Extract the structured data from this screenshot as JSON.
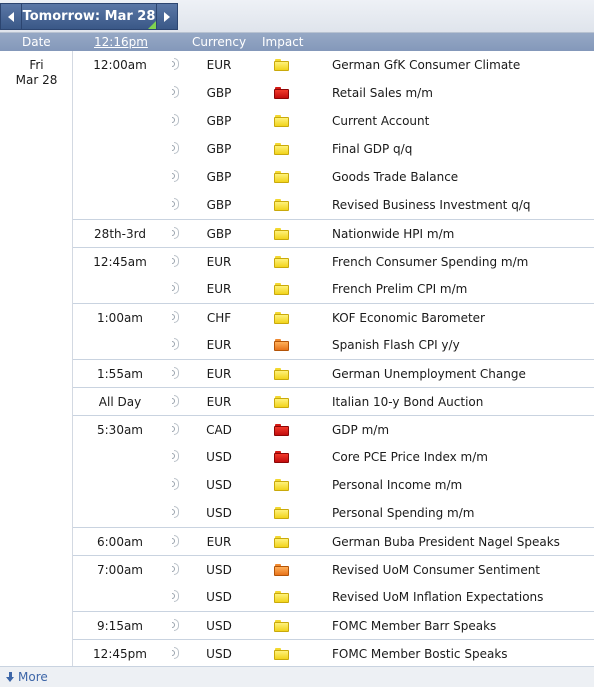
{
  "nav": {
    "label": "Tomorrow: Mar 28"
  },
  "header": {
    "date": "Date",
    "time": "12:16pm",
    "currency": "Currency",
    "impact": "Impact"
  },
  "day": {
    "weekday": "Fri",
    "date": "Mar 28"
  },
  "impact_colors": {
    "yellow": "#f1d31b",
    "red": "#c20d0d",
    "orange": "#e8731a"
  },
  "rows": [
    {
      "time": "12:00am",
      "currency": "EUR",
      "impact": "yellow",
      "event": "German GfK Consumer Climate"
    },
    {
      "time": "",
      "currency": "GBP",
      "impact": "red",
      "event": "Retail Sales m/m"
    },
    {
      "time": "",
      "currency": "GBP",
      "impact": "yellow",
      "event": "Current Account"
    },
    {
      "time": "",
      "currency": "GBP",
      "impact": "yellow",
      "event": "Final GDP q/q"
    },
    {
      "time": "",
      "currency": "GBP",
      "impact": "yellow",
      "event": "Goods Trade Balance"
    },
    {
      "time": "",
      "currency": "GBP",
      "impact": "yellow",
      "event": "Revised Business Investment q/q"
    },
    {
      "time": "28th-3rd",
      "currency": "GBP",
      "impact": "yellow",
      "event": "Nationwide HPI m/m"
    },
    {
      "time": "12:45am",
      "currency": "EUR",
      "impact": "yellow",
      "event": "French Consumer Spending m/m"
    },
    {
      "time": "",
      "currency": "EUR",
      "impact": "yellow",
      "event": "French Prelim CPI m/m"
    },
    {
      "time": "1:00am",
      "currency": "CHF",
      "impact": "yellow",
      "event": "KOF Economic Barometer"
    },
    {
      "time": "",
      "currency": "EUR",
      "impact": "orange",
      "event": "Spanish Flash CPI y/y"
    },
    {
      "time": "1:55am",
      "currency": "EUR",
      "impact": "yellow",
      "event": "German Unemployment Change"
    },
    {
      "time": "All Day",
      "currency": "EUR",
      "impact": "yellow",
      "event": "Italian 10-y Bond Auction"
    },
    {
      "time": "5:30am",
      "currency": "CAD",
      "impact": "red",
      "event": "GDP m/m"
    },
    {
      "time": "",
      "currency": "USD",
      "impact": "red",
      "event": "Core PCE Price Index m/m"
    },
    {
      "time": "",
      "currency": "USD",
      "impact": "yellow",
      "event": "Personal Income m/m"
    },
    {
      "time": "",
      "currency": "USD",
      "impact": "yellow",
      "event": "Personal Spending m/m"
    },
    {
      "time": "6:00am",
      "currency": "EUR",
      "impact": "yellow",
      "event": "German Buba President Nagel Speaks"
    },
    {
      "time": "7:00am",
      "currency": "USD",
      "impact": "orange",
      "event": "Revised UoM Consumer Sentiment"
    },
    {
      "time": "",
      "currency": "USD",
      "impact": "yellow",
      "event": "Revised UoM Inflation Expectations"
    },
    {
      "time": "9:15am",
      "currency": "USD",
      "impact": "yellow",
      "event": "FOMC Member Barr Speaks"
    },
    {
      "time": "12:45pm",
      "currency": "USD",
      "impact": "yellow",
      "event": "FOMC Member Bostic Speaks"
    }
  ],
  "footer": {
    "more": "More"
  }
}
